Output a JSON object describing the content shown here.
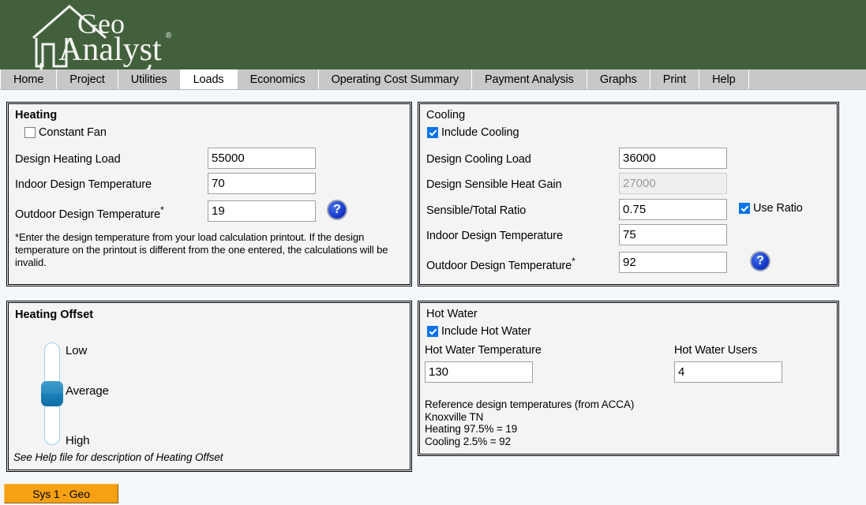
{
  "app": {
    "logo_text_top": "Geo",
    "logo_text_bottom": "Analyst",
    "logo_registered": "®",
    "header_color": "#42603c"
  },
  "nav": {
    "active": "Loads",
    "tabs": [
      {
        "label": "Home"
      },
      {
        "label": "Project"
      },
      {
        "label": "Utilities"
      },
      {
        "label": "Loads"
      },
      {
        "label": "Economics"
      },
      {
        "label": "Operating Cost Summary"
      },
      {
        "label": "Payment Analysis"
      },
      {
        "label": "Graphs"
      },
      {
        "label": "Print"
      },
      {
        "label": "Help"
      }
    ]
  },
  "heating": {
    "title": "Heating",
    "constant_fan_label": "Constant Fan",
    "constant_fan_checked": false,
    "design_heating_load_label": "Design Heating Load",
    "design_heating_load_value": "55000",
    "indoor_design_temp_label": "Indoor Design Temperature",
    "indoor_design_temp_value": "70",
    "outdoor_design_temp_label": "Outdoor Design Temperature",
    "outdoor_design_temp_star": "*",
    "outdoor_design_temp_value": "19",
    "help_icon": "?",
    "footnote": "*Enter the design temperature from your load calculation printout.  If the design temperature on the printout is different from the one entered, the calculations will be invalid."
  },
  "cooling": {
    "title": "Cooling",
    "include_cooling_label": "Include Cooling",
    "include_cooling_checked": true,
    "design_cooling_load_label": "Design Cooling Load",
    "design_cooling_load_value": "36000",
    "design_sensible_heat_gain_label": "Design Sensible Heat Gain",
    "design_sensible_heat_gain_value": "27000",
    "sensible_total_ratio_label": "Sensible/Total Ratio",
    "sensible_total_ratio_value": "0.75",
    "use_ratio_label": "Use Ratio",
    "use_ratio_checked": true,
    "indoor_design_temp_label": "Indoor Design Temperature",
    "indoor_design_temp_value": "75",
    "outdoor_design_temp_label": "Outdoor Design Temperature",
    "outdoor_design_temp_star": "*",
    "outdoor_design_temp_value": "92",
    "help_icon": "?"
  },
  "heating_offset": {
    "title": "Heating Offset",
    "labels": {
      "low": "Low",
      "average": "Average",
      "high": "High"
    },
    "selected": "Average",
    "footnote": "See Help file for description of Heating Offset"
  },
  "hot_water": {
    "title": "Hot Water",
    "include_hot_water_label": "Include Hot Water",
    "include_hot_water_checked": true,
    "temperature_label": "Hot Water Temperature",
    "temperature_value": "130",
    "users_label": "Hot Water Users",
    "users_value": "4",
    "reference_text": "Reference design temperatures (from ACCA)\nKnoxville TN\nHeating 97.5% = 19\nCooling 2.5% = 92"
  },
  "footer": {
    "system_button_label": "Sys 1 - Geo",
    "system_button_color": "#f5a113"
  }
}
